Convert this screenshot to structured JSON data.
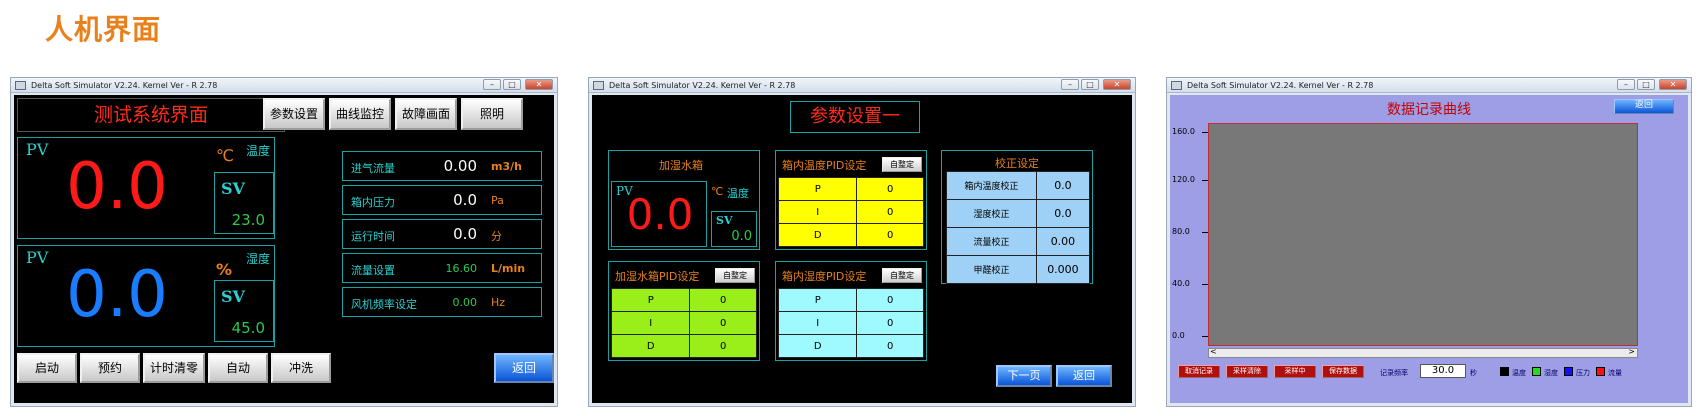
{
  "page": {
    "title": "人机界面"
  },
  "window_title": "Delta Soft Simulator V2.24. Kernel Ver - R 2.78",
  "win1": {
    "title": "测试系统界面",
    "nav": [
      "参数设置",
      "曲线监控",
      "故障画面",
      "照明"
    ],
    "temp": {
      "pv_label": "PV",
      "pv": "0.0",
      "unit": "℃",
      "name": "温度",
      "sv_label": "SV",
      "sv": "23.0"
    },
    "hum": {
      "pv_label": "PV",
      "pv": "0.0",
      "unit": "%",
      "name": "湿度",
      "sv_label": "SV",
      "sv": "45.0"
    },
    "rows": [
      {
        "label": "进气流量",
        "value": "0.00",
        "unit": "m3/h"
      },
      {
        "label": "箱内压力",
        "value": "0.0",
        "unit": "Pa"
      },
      {
        "label": "运行时间",
        "value": "0.0",
        "unit": "分"
      },
      {
        "label": "流量设置",
        "value": "16.60",
        "unit": "L/min"
      },
      {
        "label": "风机频率设定",
        "value": "0.00",
        "unit": "Hz"
      }
    ],
    "bottom": [
      "启动",
      "预约",
      "计时清零",
      "自动",
      "冲洗"
    ],
    "back": "返回"
  },
  "win2": {
    "title": "参数设置一",
    "humidifier": {
      "title": "加湿水箱",
      "pv_label": "PV",
      "pv": "0.0",
      "unit": "℃",
      "name": "温度",
      "sv_label": "SV",
      "sv": "0.0"
    },
    "self_tune": "自整定",
    "pid_box_temp": {
      "title": "箱内温度PID设定",
      "color": "#ffff00",
      "rows": [
        [
          "P",
          "0"
        ],
        [
          "I",
          "0"
        ],
        [
          "D",
          "0"
        ]
      ]
    },
    "pid_humidifier": {
      "title": "加湿水箱PID设定",
      "color": "#9aef1a",
      "rows": [
        [
          "P",
          "0"
        ],
        [
          "I",
          "0"
        ],
        [
          "D",
          "0"
        ]
      ]
    },
    "pid_box_hum": {
      "title": "箱内湿度PID设定",
      "color": "#9ffaff",
      "rows": [
        [
          "P",
          "0"
        ],
        [
          "I",
          "0"
        ],
        [
          "D",
          "0"
        ]
      ]
    },
    "calibration": {
      "title": "校正设定",
      "rows": [
        [
          "箱内温度校正",
          "0.0"
        ],
        [
          "湿度校正",
          "0.0"
        ],
        [
          "流量校正",
          "0.00"
        ],
        [
          "甲醛校正",
          "0.000"
        ]
      ]
    },
    "next": "下一页",
    "back": "返回"
  },
  "win3": {
    "title": "数据记录曲线",
    "back": "返回",
    "y_ticks": [
      "160.0",
      "120.0",
      "80.0",
      "40.0",
      "0.0"
    ],
    "buttons": [
      "取消记录",
      "采样清除",
      "采样中",
      "保存数据"
    ],
    "rate_label": "记录频率",
    "rate_value": "30.0",
    "rate_unit": "秒",
    "legend": [
      {
        "name": "温度",
        "color": "#000000"
      },
      {
        "name": "湿度",
        "color": "#22dd22"
      },
      {
        "name": "压力",
        "color": "#1010ff"
      },
      {
        "name": "流量",
        "color": "#ff1010"
      }
    ]
  }
}
